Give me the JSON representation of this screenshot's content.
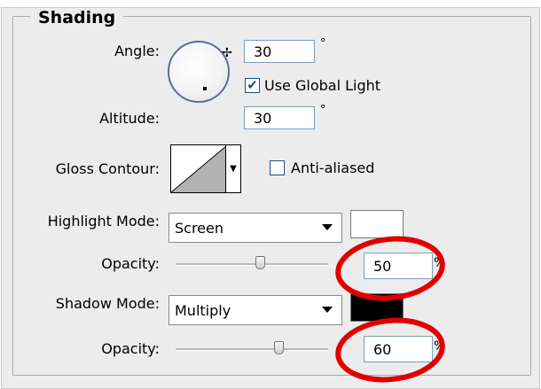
{
  "group_title": "Shading",
  "structure": {
    "angle_label": "Angle:",
    "angle_value": "30",
    "angle_unit": "°",
    "use_global_light_label": "Use Global Light",
    "use_global_light_checked": true,
    "altitude_label": "Altitude:",
    "altitude_value": "30",
    "altitude_unit": "°"
  },
  "gloss": {
    "label": "Gloss Contour:",
    "anti_aliased_label": "Anti-aliased",
    "anti_aliased_checked": false
  },
  "highlight": {
    "mode_label": "Highlight Mode:",
    "mode_value": "Screen",
    "color": "#ffffff",
    "opacity_label": "Opacity:",
    "opacity_value": "50",
    "opacity_unit": "%"
  },
  "shadow": {
    "mode_label": "Shadow Mode:",
    "mode_value": "Multiply",
    "color": "#000000",
    "opacity_label": "Opacity:",
    "opacity_value": "60",
    "opacity_unit": "%"
  },
  "annotation_color": "#e00000",
  "icons": {
    "dial_crosshair": "crosshair-icon",
    "dropdown": "chevron-down-icon",
    "check": "checkmark-icon"
  }
}
